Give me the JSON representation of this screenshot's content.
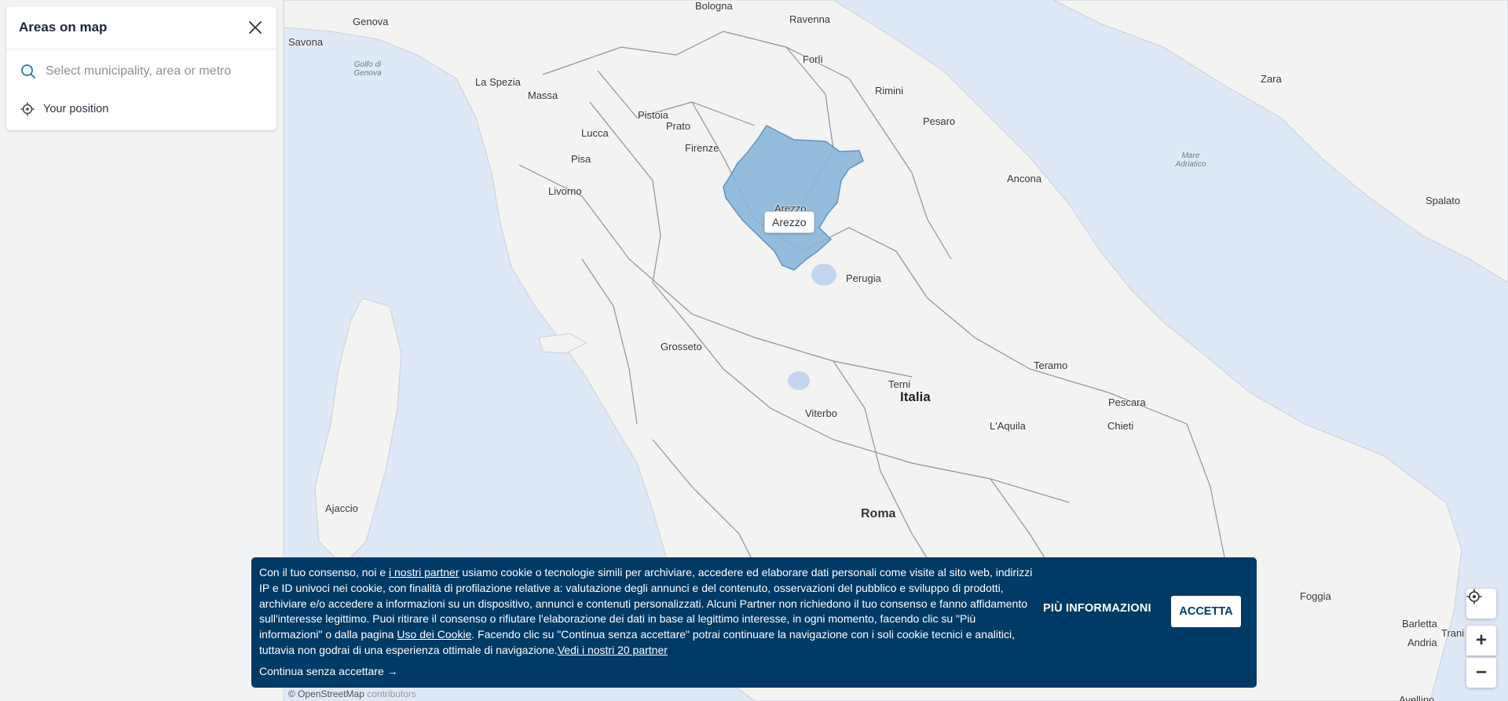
{
  "panel": {
    "title": "Areas on map",
    "search_placeholder": "Select municipality, area or metro",
    "position_label": "Your position"
  },
  "map": {
    "selected_area_tooltip": "Arezzo",
    "country_label": "Italia",
    "cities": {
      "genova": "Genova",
      "bologna": "Bologna",
      "ravenna": "Ravenna",
      "savona": "Savona",
      "forli": "Forlì",
      "la_spezia": "La Spezia",
      "massa": "Massa",
      "rimini": "Rimini",
      "pistoia": "Pistoia",
      "prato": "Prato",
      "pesaro": "Pesaro",
      "lucca": "Lucca",
      "firenze": "Firenze",
      "pisa": "Pisa",
      "livorno": "Livorno",
      "ancona": "Ancona",
      "arezzo": "Arezzo",
      "perugia": "Perugia",
      "grosseto": "Grosseto",
      "teramo": "Teramo",
      "terni": "Terni",
      "pescara": "Pescara",
      "viterbo": "Viterbo",
      "laquila": "L'Aquila",
      "chieti": "Chieti",
      "ajaccio": "Ajaccio",
      "roma": "Roma",
      "zara": "Zara",
      "spalato": "Spalato",
      "foggia": "Foggia",
      "barletta": "Barletta",
      "trani": "Trani",
      "andria": "Andria",
      "avellino": "Avellino"
    },
    "seas": {
      "golfo_genova": "Golfo di Genova",
      "mare_adriatico": "Mare Adriatico"
    },
    "attribution": "© OpenStreetMap",
    "attribution_suffix": "contributors",
    "colors": {
      "sea": "#dfe8f7",
      "land": "#f3f3f1",
      "selected_area": "#8ab6d9",
      "borders": "#8a93a6"
    }
  },
  "controls": {
    "locate_icon": "crosshair-icon",
    "zoom_in": "+",
    "zoom_out": "−"
  },
  "cookie": {
    "text_1": "Con il tuo consenso, noi e ",
    "partner_link": "i nostri partner",
    "text_2": " usiamo cookie o tecnologie simili per archiviare, accedere ed elaborare dati personali come visite al sito web, indirizzi IP e ID univoci nei cookie, con finalità di profilazione relative a: valutazione degli annunci e del contenuto, osservazioni del pubblico e sviluppo di prodotti, archiviare e/o accedere a informazioni su un dispositivo, annunci e contenuti personalizzati. Alcuni Partner non richiedono il tuo consenso e fanno affidamento sull'interesse legittimo. Puoi ritirare il consenso o rifiutare l'elaborazione dei dati in base al legittimo interesse, in ogni momento, facendo clic su \"Più informazioni\" o dalla pagina ",
    "cookie_link": "Uso dei Cookie",
    "text_3": ". Facendo clic su \"Continua senza accettare\" potrai continuare la navigazione con i soli cookie tecnici e analitici, tuttavia non godrai di una esperienza ottimale di navigazione.",
    "partners_count_link": "Vedi i nostri 20 partner",
    "continue_label": "Continua senza accettare →",
    "more_info_label": "PIÙ INFORMAZIONI",
    "accept_label": "ACCETTA"
  }
}
